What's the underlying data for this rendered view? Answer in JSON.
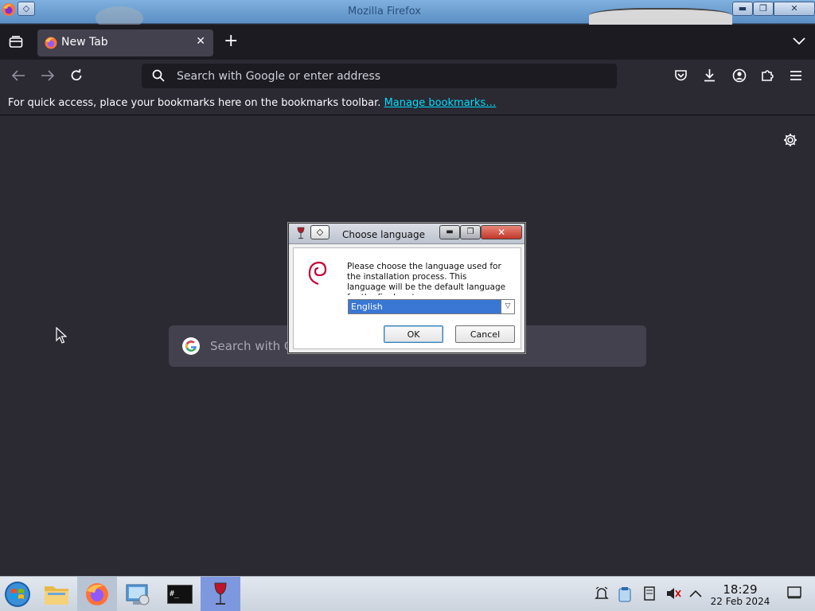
{
  "window": {
    "title": "Mozilla Firefox",
    "minimize_glyph": "▬",
    "maximize_glyph": "❐",
    "close_glyph": "✕"
  },
  "tabs": [
    {
      "label": "New Tab",
      "icon": "firefox-icon",
      "close_glyph": "✕",
      "active": true
    }
  ],
  "new_tab_glyph": "+",
  "urlbar": {
    "placeholder": "Search with Google or enter address",
    "value": ""
  },
  "bookmarks_bar": {
    "message": "For quick access, place your bookmarks here on the bookmarks toolbar.",
    "link": "Manage bookmarks…"
  },
  "newtab": {
    "search_placeholder": "Search with Google or enter address"
  },
  "dialog": {
    "title": "Choose language",
    "pin_glyph": "◇",
    "message": "Please choose the language used for the installation process. This language will be the default language for the final system.",
    "language_options": [
      "English"
    ],
    "selected_language": "English",
    "ok_label": "OK",
    "cancel_label": "Cancel"
  },
  "taskbar": {
    "items": [
      "start-button",
      "file-manager",
      "firefox",
      "system-settings",
      "terminal",
      "wine"
    ],
    "terminal_text": "#_"
  },
  "clock": {
    "time": "18:29",
    "date": "22 Feb 2024"
  },
  "colors": {
    "accent": "#00ddff",
    "background": "#2b2a33",
    "tabstrip": "#1c1b22",
    "selection": "#3a77d4"
  }
}
